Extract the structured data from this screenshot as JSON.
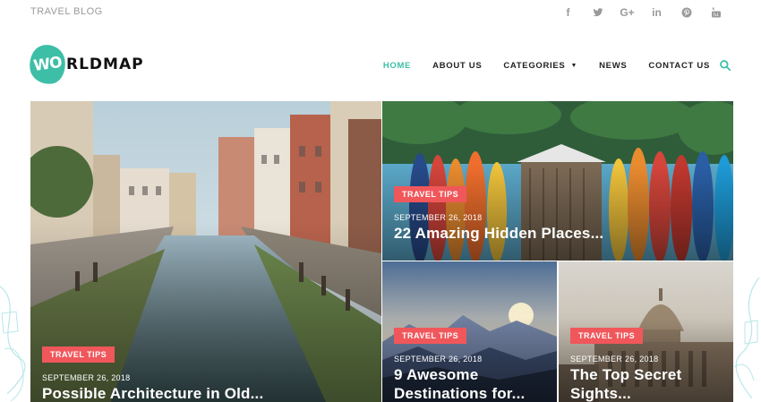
{
  "topbar": {
    "label": "TRAVEL BLOG",
    "socials": [
      {
        "icon": "facebook-icon",
        "glyph": "f"
      },
      {
        "icon": "twitter-icon",
        "glyph": ""
      },
      {
        "icon": "google-plus-icon",
        "glyph": "G+"
      },
      {
        "icon": "linkedin-icon",
        "glyph": "in"
      },
      {
        "icon": "pinterest-icon",
        "glyph": ""
      },
      {
        "icon": "youtube-icon",
        "glyph": ""
      }
    ]
  },
  "logo": {
    "mark": "WO",
    "text": "RLDMAP",
    "color": "#3dbfa7"
  },
  "nav": {
    "home": "HOME",
    "about": "ABOUT US",
    "categories": "CATEGORIES",
    "news": "NEWS",
    "contact": "CONTACT US"
  },
  "colors": {
    "accent": "#3dbfa7",
    "badge": "#f0575b"
  },
  "posts": [
    {
      "category": "TRAVEL TIPS",
      "date": "SEPTEMBER 26, 2018",
      "title": "Possible Architecture in Old..."
    },
    {
      "category": "TRAVEL TIPS",
      "date": "SEPTEMBER 26, 2018",
      "title": "22 Amazing Hidden Places..."
    },
    {
      "category": "TRAVEL TIPS",
      "date": "SEPTEMBER 26, 2018",
      "title_line1": "9 Awesome",
      "title_line2": "Destinations for..."
    },
    {
      "category": "TRAVEL TIPS",
      "date": "SEPTEMBER 26, 2018",
      "title_line1": "The Top Secret",
      "title_line2": "Sights..."
    }
  ]
}
